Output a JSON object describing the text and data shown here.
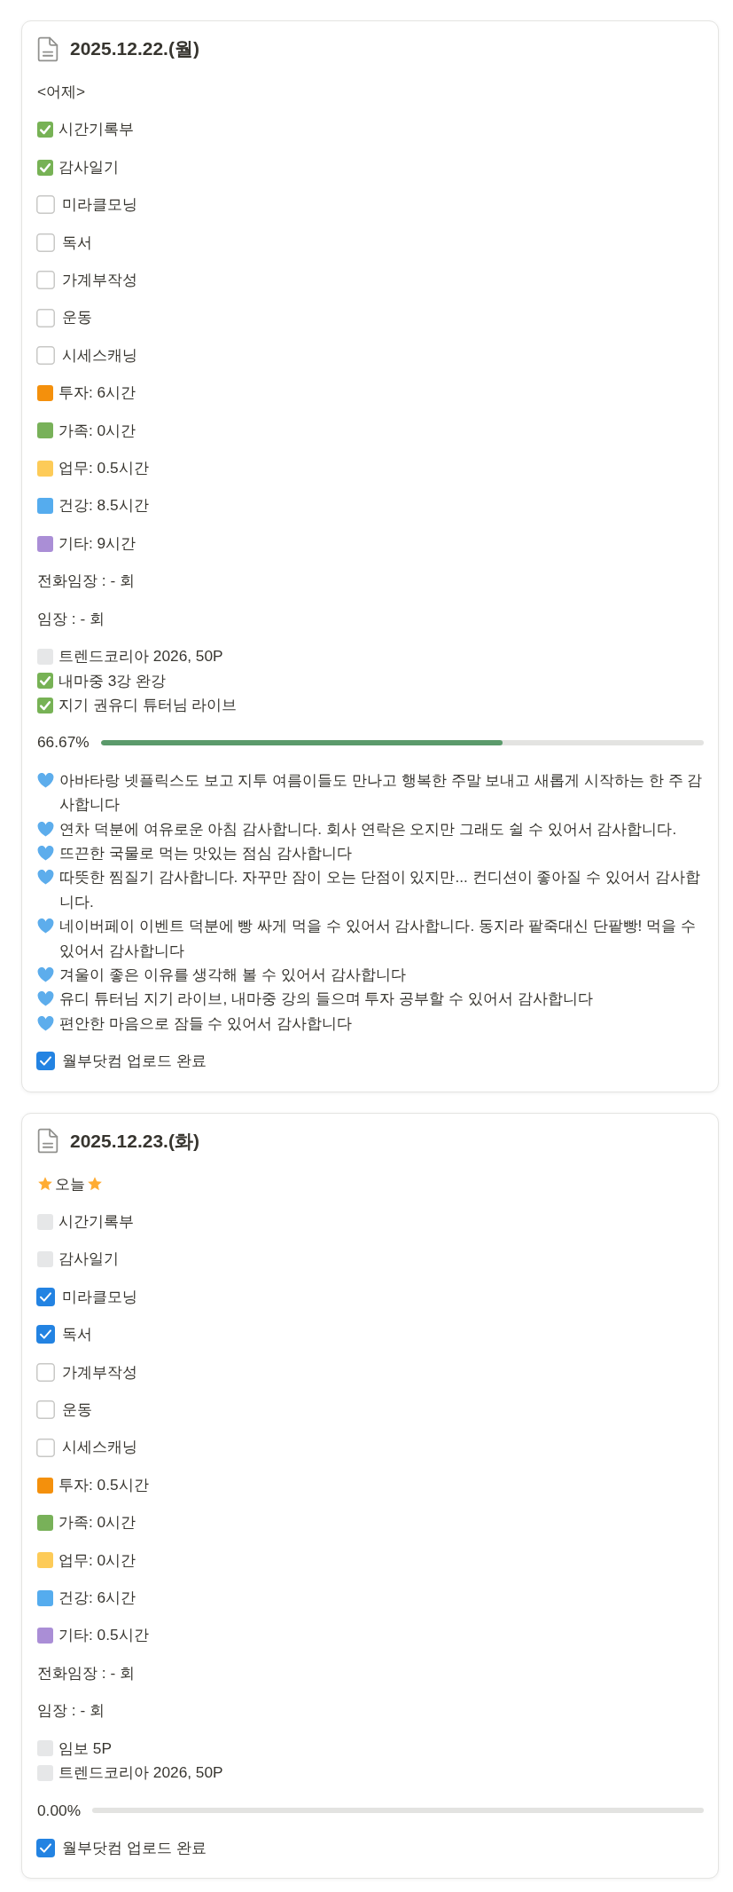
{
  "cards": [
    {
      "title": "2025.12.22.(월)",
      "rows": [
        {
          "kind": "text",
          "text": "<어제>"
        },
        {
          "kind": "emoji-check",
          "text": "시간기록부",
          "done": true
        },
        {
          "kind": "emoji-check",
          "text": "감사일기",
          "done": true
        },
        {
          "kind": "checkbox",
          "text": "미라클모닝",
          "checked": false
        },
        {
          "kind": "checkbox",
          "text": "독서",
          "checked": false
        },
        {
          "kind": "checkbox",
          "text": "가계부작성",
          "checked": false
        },
        {
          "kind": "checkbox",
          "text": "운동",
          "checked": false
        },
        {
          "kind": "checkbox",
          "text": "시세스캐닝",
          "checked": false
        },
        {
          "kind": "category",
          "text": "투자: 6시간",
          "color": "#f4900c"
        },
        {
          "kind": "category",
          "text": "가족: 0시간",
          "color": "#78b159"
        },
        {
          "kind": "category",
          "text": "업무: 0.5시간",
          "color": "#fdcb58"
        },
        {
          "kind": "category",
          "text": "건강: 8.5시간",
          "color": "#55acee"
        },
        {
          "kind": "category",
          "text": "기타: 9시간",
          "color": "#aa8ed6"
        },
        {
          "kind": "text",
          "text": "전화임장 : - 회"
        },
        {
          "kind": "text",
          "text": "임장 : - 회"
        },
        {
          "kind": "checklist",
          "items": [
            {
              "text": "트렌드코리아 2026, 50P",
              "done": false
            },
            {
              "text": "내마중 3강 완강",
              "done": true
            },
            {
              "text": "지기 권유디 튜터님 라이브",
              "done": true
            }
          ]
        },
        {
          "kind": "progress",
          "text": "66.67%",
          "level": 0.6667
        },
        {
          "kind": "gratitude",
          "lines": [
            "아바타랑 넷플릭스도 보고 지투 여름이들도 만나고 행복한 주말 보내고 새롭게 시작하는 한 주 감사합니다",
            "연차 덕분에 여유로운 아침 감사합니다. 회사 연락은 오지만 그래도 쉴 수 있어서 감사합니다.",
            "뜨끈한 국물로 먹는 맛있는 점심 감사합니다",
            "따뜻한 찜질기 감사합니다. 자꾸만 잠이 오는 단점이 있지만... 컨디션이 좋아질 수 있어서 감사합니다.",
            "네이버페이 이벤트 덕분에 빵 싸게 먹을 수 있어서 감사합니다. 동지라 팥죽대신 단팥빵! 먹을 수 있어서 감사합니다",
            "겨울이 좋은 이유를 생각해 볼 수 있어서 감사합니다",
            "유디 튜터님 지기 라이브, 내마중 강의 들으며 투자 공부할 수 있어서 감사합니다",
            "편안한 마음으로 잠들 수 있어서 감사합니다"
          ]
        },
        {
          "kind": "checkbox",
          "text": "월부닷컴 업로드 완료",
          "checked": true
        }
      ]
    },
    {
      "title": "2025.12.23.(화)",
      "rows": [
        {
          "kind": "starred",
          "text": "오늘"
        },
        {
          "kind": "emoji-check",
          "text": "시간기록부",
          "done": false
        },
        {
          "kind": "emoji-check",
          "text": "감사일기",
          "done": false
        },
        {
          "kind": "checkbox",
          "text": "미라클모닝",
          "checked": true
        },
        {
          "kind": "checkbox",
          "text": "독서",
          "checked": true
        },
        {
          "kind": "checkbox",
          "text": "가계부작성",
          "checked": false
        },
        {
          "kind": "checkbox",
          "text": "운동",
          "checked": false
        },
        {
          "kind": "checkbox",
          "text": "시세스캐닝",
          "checked": false
        },
        {
          "kind": "category",
          "text": "투자: 0.5시간",
          "color": "#f4900c"
        },
        {
          "kind": "category",
          "text": "가족: 0시간",
          "color": "#78b159"
        },
        {
          "kind": "category",
          "text": "업무: 0시간",
          "color": "#fdcb58"
        },
        {
          "kind": "category",
          "text": "건강: 6시간",
          "color": "#55acee"
        },
        {
          "kind": "category",
          "text": "기타: 0.5시간",
          "color": "#aa8ed6"
        },
        {
          "kind": "text",
          "text": "전화임장 : - 회"
        },
        {
          "kind": "text",
          "text": "임장 : - 회"
        },
        {
          "kind": "checklist",
          "items": [
            {
              "text": "임보 5P",
              "done": false
            },
            {
              "text": "트렌드코리아 2026, 50P",
              "done": false
            }
          ]
        },
        {
          "kind": "progress",
          "text": "0.00%",
          "level": 0
        },
        {
          "kind": "checkbox",
          "text": "월부닷컴 업로드 완료",
          "checked": true
        }
      ]
    }
  ]
}
